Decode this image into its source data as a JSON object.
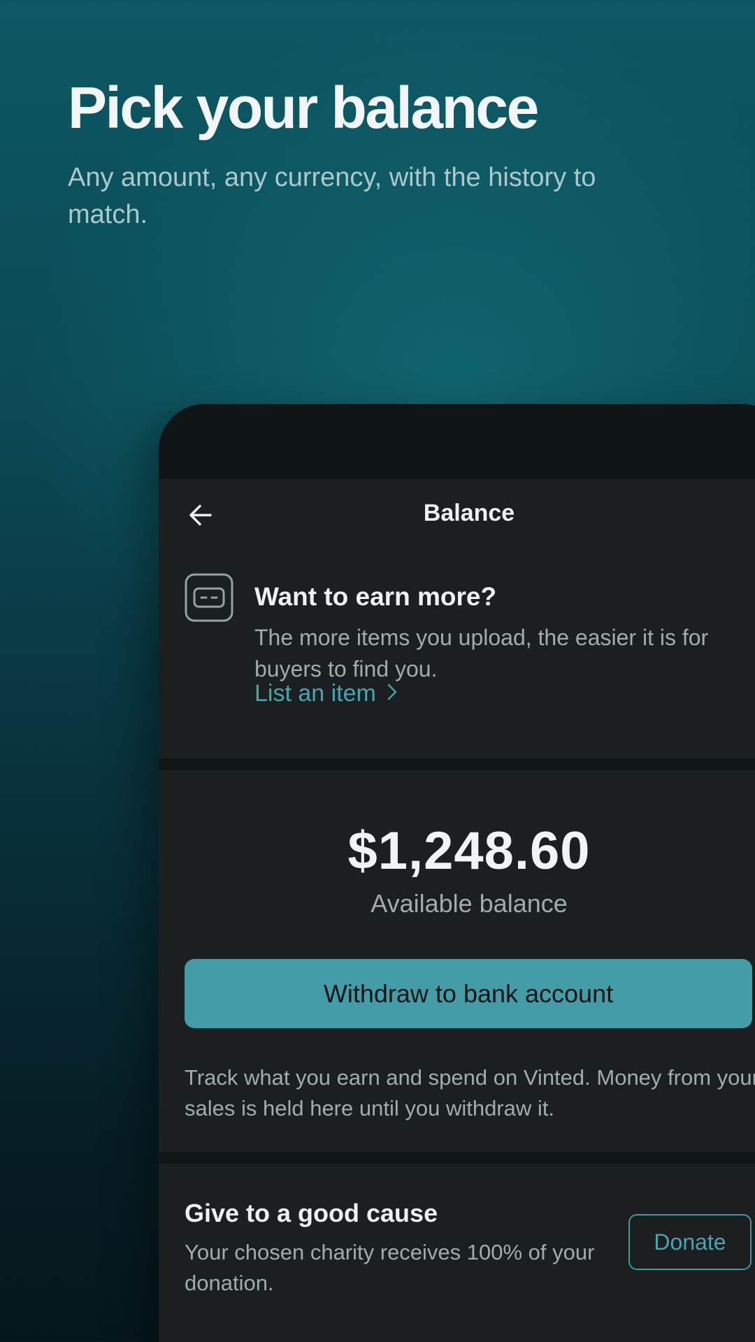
{
  "marketing": {
    "headline": "Pick your balance",
    "subhead": "Any amount, any currency, with the history to match."
  },
  "app_bar": {
    "title": "Balance",
    "back_icon": "arrow-left-icon"
  },
  "promo": {
    "icon": "wallet-card-icon",
    "title": "Want to earn more?",
    "body": "The more items you upload, the easier it is for buyers to find you.",
    "link_label": "List an item"
  },
  "balance": {
    "amount": "$1,248.60",
    "label": "Available balance",
    "withdraw_label": "Withdraw to bank account",
    "info": "Track what you earn and spend on Vinted. Money from your sales is held here until you withdraw it."
  },
  "charity": {
    "title": "Give to a good cause",
    "body": "Your chosen charity receives 100% of your donation.",
    "donate_label": "Donate"
  },
  "colors": {
    "accent": "#449ca6",
    "link": "#4ba3ad",
    "screen_bg": "#1b1f20",
    "background_top": "#0c5864",
    "background_bottom": "#05171c"
  }
}
